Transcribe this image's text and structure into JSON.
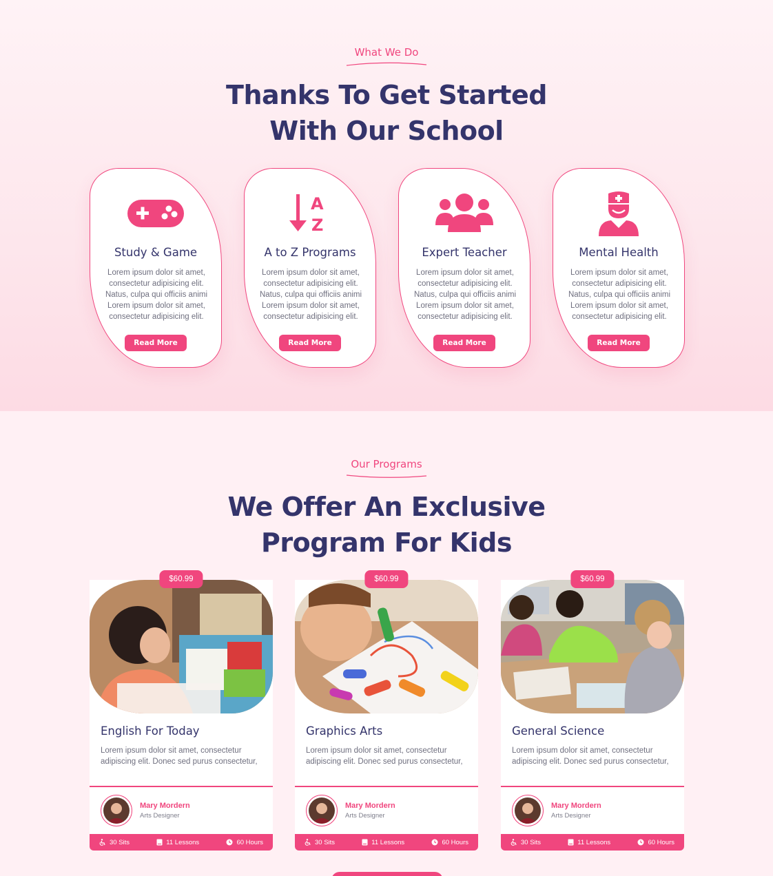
{
  "what_we_do": {
    "eyebrow": "What We Do",
    "headline_line1": "Thanks To Get Started",
    "headline_line2": "With Our School",
    "features": [
      {
        "icon": "gamepad-icon",
        "title": "Study & Game",
        "text": "Lorem ipsum dolor sit amet, consectetur adipisicing elit. Natus, culpa qui officiis animi Lorem ipsum dolor sit amet, consectetur adipisicing elit.",
        "button": "Read More"
      },
      {
        "icon": "sort-az-icon",
        "title": "A to Z Programs",
        "text": "Lorem ipsum dolor sit amet, consectetur adipisicing elit. Natus, culpa qui officiis animi Lorem ipsum dolor sit amet, consectetur adipisicing elit.",
        "button": "Read More"
      },
      {
        "icon": "users-group-icon",
        "title": "Expert Teacher",
        "text": "Lorem ipsum dolor sit amet, consectetur adipisicing elit. Natus, culpa qui officiis animi Lorem ipsum dolor sit amet, consectetur adipisicing elit.",
        "button": "Read More"
      },
      {
        "icon": "nurse-icon",
        "title": "Mental Health",
        "text": "Lorem ipsum dolor sit amet, consectetur adipisicing elit. Natus, culpa qui officiis animi Lorem ipsum dolor sit amet, consectetur adipisicing elit.",
        "button": "Read More"
      }
    ]
  },
  "programs": {
    "eyebrow": "Our Programs",
    "headline_line1": "We Offer An Exclusive",
    "headline_line2": "Program For Kids",
    "items": [
      {
        "price": "$60.99",
        "title": "English For Today",
        "text": "Lorem ipsum dolor sit amet, consectetur adipiscing elit. Donec sed purus consectetur,",
        "author_name": "Mary Mordern",
        "author_role": "Arts Designer",
        "sits": "30 Sits",
        "lessons": "11 Lessons",
        "hours": "60 Hours"
      },
      {
        "price": "$60.99",
        "title": "Graphics Arts",
        "text": "Lorem ipsum dolor sit amet, consectetur adipiscing elit. Donec sed purus consectetur,",
        "author_name": "Mary Mordern",
        "author_role": "Arts Designer",
        "sits": "30 Sits",
        "lessons": "11 Lessons",
        "hours": "60 Hours"
      },
      {
        "price": "$60.99",
        "title": "General Science",
        "text": "Lorem ipsum dolor sit amet, consectetur adipiscing elit. Donec sed purus consectetur,",
        "author_name": "Mary Mordern",
        "author_role": "Arts Designer",
        "sits": "30 Sits",
        "lessons": "11 Lessons",
        "hours": "60 Hours"
      }
    ]
  },
  "colors": {
    "accent": "#f0467e",
    "heading": "#34346b",
    "body_text": "#6f6f7f"
  }
}
